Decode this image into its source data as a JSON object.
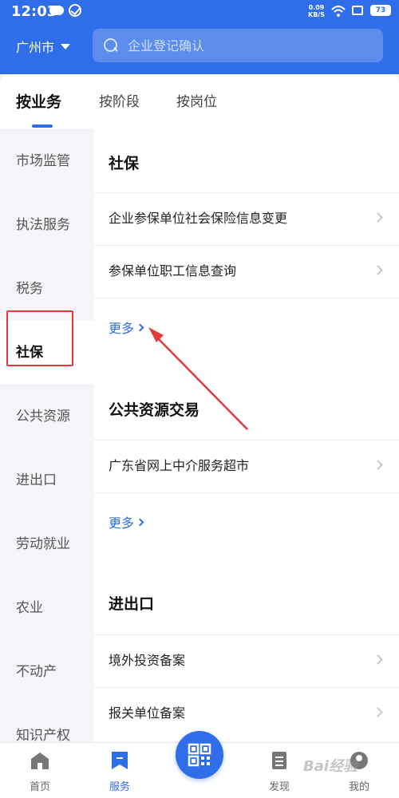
{
  "status": {
    "time": "12:03",
    "speed_top": "0.09",
    "speed_unit": "KB/S",
    "battery": "73"
  },
  "header": {
    "city": "广州市",
    "search_placeholder": "企业登记确认"
  },
  "tabs": [
    {
      "label": "按业务"
    },
    {
      "label": "按阶段"
    },
    {
      "label": "按岗位"
    }
  ],
  "sidebar": {
    "items": [
      {
        "label": "市场监管"
      },
      {
        "label": "执法服务"
      },
      {
        "label": "税务"
      },
      {
        "label": "社保"
      },
      {
        "label": "公共资源"
      },
      {
        "label": "进出口"
      },
      {
        "label": "劳动就业"
      },
      {
        "label": "农业"
      },
      {
        "label": "不动产"
      },
      {
        "label": "知识产权"
      }
    ]
  },
  "sections": [
    {
      "title": "社保",
      "items": [
        "企业参保单位社会保险信息变更",
        "参保单位职工信息查询"
      ],
      "more": "更多"
    },
    {
      "title": "公共资源交易",
      "items": [
        "广东省网上中介服务超市"
      ],
      "more": "更多"
    },
    {
      "title": "进出口",
      "items": [
        "境外投资备案",
        "报关单位备案"
      ]
    }
  ],
  "bottom_nav": [
    {
      "label": "首页",
      "icon": "home-icon"
    },
    {
      "label": "服务",
      "icon": "bookmark-icon"
    },
    {
      "label": "发现",
      "icon": "document-icon"
    },
    {
      "label": "我的",
      "icon": "profile-icon"
    }
  ],
  "watermark": "Bai经验",
  "colors": {
    "primary": "#2f6ee8",
    "annotation": "#e23b3b"
  }
}
